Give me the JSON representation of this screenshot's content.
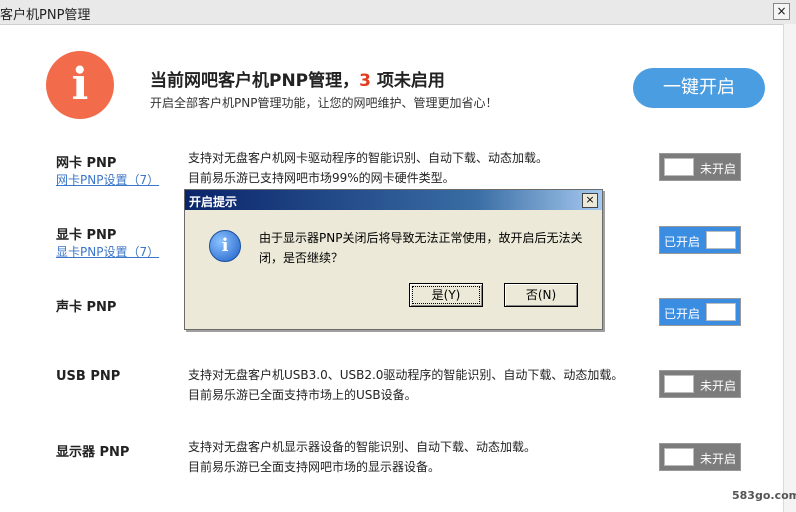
{
  "window": {
    "title": "客户机PNP管理",
    "close_label": "×"
  },
  "header": {
    "headline_prefix": "当前网吧客户机PNP管理，",
    "disabled_count": "3",
    "headline_suffix": " 项未启用",
    "subline": "开启全部客户机PNP管理功能，让您的网吧维护、管理更加省心！",
    "enable_all_label": "一键开启",
    "info_glyph": "i"
  },
  "rows": [
    {
      "title": "网卡 PNP",
      "link": "网卡PNP设置（7）",
      "desc1": "支持对无盘客户机网卡驱动程序的智能识别、自动下载、动态加载。",
      "desc2": "目前易乐游已支持网吧市场99%的网卡硬件类型。",
      "toggle": "未开启"
    },
    {
      "title": "显卡 PNP",
      "link": "显卡PNP设置（7）",
      "desc1": "",
      "desc2": "",
      "toggle": "已开启"
    },
    {
      "title": "声卡 PNP",
      "link": "",
      "desc1": "",
      "desc2": "",
      "toggle": "已开启"
    },
    {
      "title": "USB PNP",
      "link": "",
      "desc1": "支持对无盘客户机USB3.0、USB2.0驱动程序的智能识别、自动下载、动态加载。",
      "desc2": "目前易乐游已全面支持市场上的USB设备。",
      "toggle": "未开启"
    },
    {
      "title": "显示器 PNP",
      "link": "",
      "desc1": "支持对无盘客户机显示器设备的智能识别、自动下载、动态加载。",
      "desc2": "目前易乐游已全面支持网吧市场的显示器设备。",
      "toggle": "未开启"
    }
  ],
  "dialog": {
    "title": "开启提示",
    "close_label": "×",
    "icon_glyph": "i",
    "message": "由于显示器PNP关闭后将导致无法正常使用，故开启后无法关闭，是否继续？",
    "yes_label": "是(Y)",
    "no_label": "否(N)"
  },
  "watermark": "583go.com",
  "colors": {
    "accent": "#4a9de0",
    "warning": "#f26b4b",
    "count": "#e23c1f",
    "toggle_on": "#3a8de0",
    "toggle_off": "#7c7c7c"
  }
}
